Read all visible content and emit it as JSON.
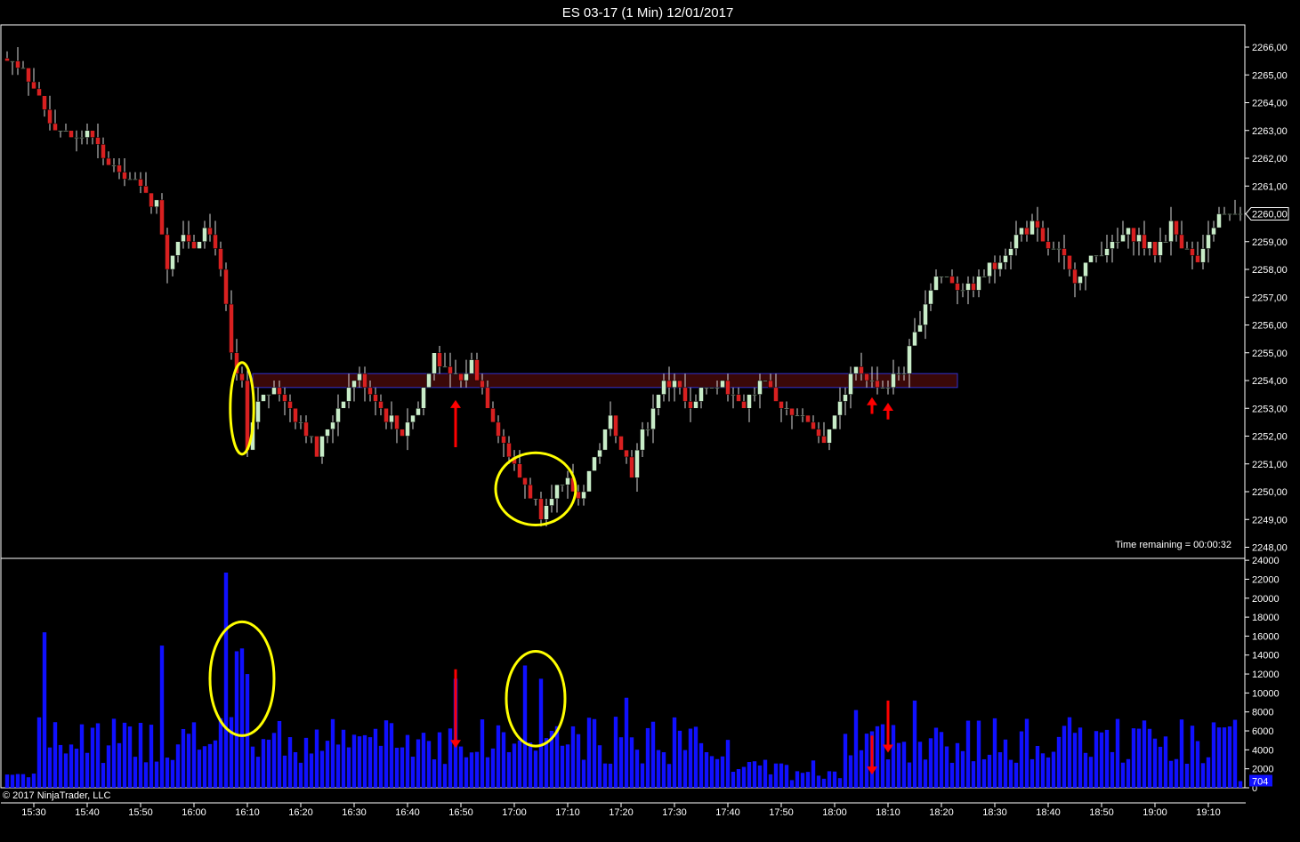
{
  "window": {
    "title": "ES 03-17 (1 Min)  12/01/2017",
    "time_remaining": "Time remaining = 00:00:32",
    "copyright": "© 2017 NinjaTrader, LLC"
  },
  "colors": {
    "background": "#000000",
    "up_candle": "#c8ecc8",
    "down_candle": "#d82020",
    "volume": "#1010ff",
    "highlight_circle": "#ffff00",
    "arrow": "#ff0000",
    "zone_border": "#3030d0",
    "zone_fill": "#3a0808"
  },
  "chart_data": [
    {
      "type": "candlestick",
      "title": "ES 03-17 (1 Min)  12/01/2017",
      "x_tick_labels": [
        "15:30",
        "15:40",
        "15:50",
        "16:00",
        "16:10",
        "16:20",
        "16:30",
        "16:40",
        "16:50",
        "17:00",
        "17:10",
        "17:20",
        "17:30",
        "17:40",
        "17:50",
        "18:00",
        "18:10",
        "18:20",
        "18:30",
        "18:40",
        "18:50",
        "19:00",
        "19:10"
      ],
      "x_range": [
        "15:25",
        "19:16"
      ],
      "y_tick_labels": [
        "2266,00",
        "2265,00",
        "2264,00",
        "2263,00",
        "2262,00",
        "2261,00",
        "2260,00",
        "2259,00",
        "2258,00",
        "2257,00",
        "2256,00",
        "2255,00",
        "2254,00",
        "2253,00",
        "2252,00",
        "2251,00",
        "2250,00",
        "2249,00",
        "2248,00"
      ],
      "y_ticks": [
        2266,
        2265,
        2264,
        2263,
        2262,
        2261,
        2260,
        2259,
        2258,
        2257,
        2256,
        2255,
        2254,
        2253,
        2252,
        2251,
        2250,
        2249,
        2248
      ],
      "ylim": [
        2247.6,
        2266.8
      ],
      "last_price": 2260.0,
      "last_price_label": "2260,00",
      "zone": {
        "from": "16:11",
        "to": "18:23",
        "low": 2253.75,
        "high": 2254.25
      },
      "annotations": [
        {
          "kind": "circle",
          "time": "16:09",
          "price": 2253.0,
          "rx_minutes": 2.2,
          "ry_price": 1.65
        },
        {
          "kind": "circle",
          "time": "17:04",
          "price": 2250.1,
          "rx_minutes": 7.5,
          "ry_price": 1.3
        },
        {
          "kind": "arrow",
          "direction": "up",
          "time": "16:49",
          "from_price": 2251.6,
          "to_price": 2253.3
        },
        {
          "kind": "arrow",
          "direction": "up",
          "time": "18:07",
          "from_price": 2252.8,
          "to_price": 2253.4
        },
        {
          "kind": "arrow",
          "direction": "up",
          "time": "18:10",
          "from_price": 2252.6,
          "to_price": 2253.2
        }
      ]
    },
    {
      "type": "bar",
      "series_label": "volume",
      "x_range": [
        "15:25",
        "19:16"
      ],
      "y_tick_labels": [
        "24000",
        "22000",
        "20000",
        "18000",
        "16000",
        "14000",
        "12000",
        "10000",
        "8000",
        "6000",
        "4000",
        "2000",
        "0"
      ],
      "y_ticks": [
        24000,
        22000,
        20000,
        18000,
        16000,
        14000,
        12000,
        10000,
        8000,
        6000,
        4000,
        2000,
        0
      ],
      "ylim": [
        0,
        24200
      ],
      "last_value": 704,
      "last_value_label": "704",
      "annotations": [
        {
          "kind": "circle",
          "time": "16:09",
          "value": 11500,
          "rx_minutes": 6.0,
          "ry_value": 6000
        },
        {
          "kind": "circle",
          "time": "17:04",
          "value": 9400,
          "rx_minutes": 5.5,
          "ry_value": 5000
        },
        {
          "kind": "arrow",
          "direction": "down",
          "time": "16:49",
          "from_value": 12500,
          "to_value": 4200
        },
        {
          "kind": "arrow",
          "direction": "down",
          "time": "18:07",
          "from_value": 5500,
          "to_value": 1400
        },
        {
          "kind": "arrow",
          "direction": "down",
          "time": "18:10",
          "from_value": 9200,
          "to_value": 3700
        }
      ]
    }
  ]
}
